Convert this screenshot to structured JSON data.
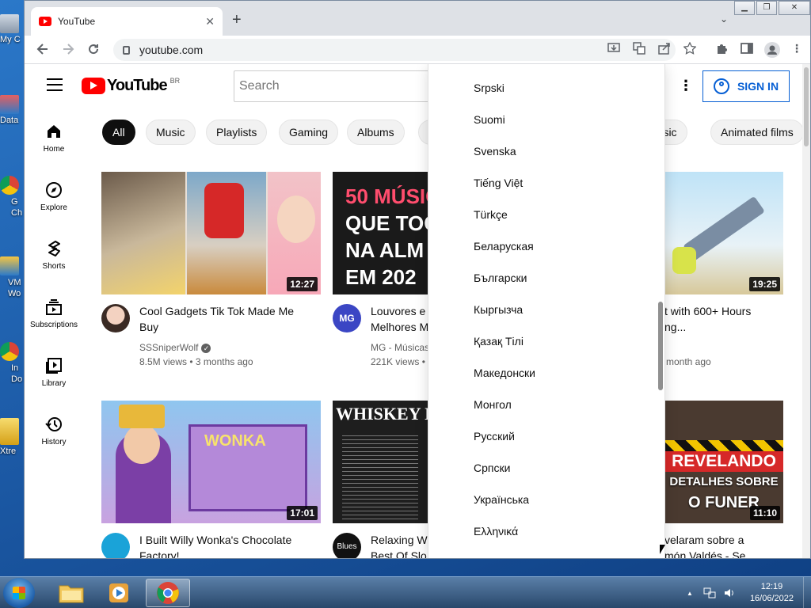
{
  "desktop": {
    "icons": [
      {
        "label": "My C"
      },
      {
        "label": "Data"
      },
      {
        "label": "G Ch"
      },
      {
        "label": "VM Wo"
      },
      {
        "label": "In Do"
      },
      {
        "label": "Xtre"
      }
    ]
  },
  "browser": {
    "tab_title": "YouTube",
    "tab_close": "✕",
    "new_tab": "+",
    "tab_search": "⌄",
    "url": "youtube.com",
    "win_minimize": "▁",
    "win_maximize": "❐",
    "win_close": "✕"
  },
  "youtube": {
    "logo_text": "YouTube",
    "country_code": "BR",
    "search_placeholder": "Search",
    "sign_in": "SIGN IN",
    "nav": [
      {
        "label": "Home"
      },
      {
        "label": "Explore"
      },
      {
        "label": "Shorts"
      },
      {
        "label": "Subscriptions"
      },
      {
        "label": "Library"
      },
      {
        "label": "History"
      }
    ],
    "chips": [
      "All",
      "Music",
      "Playlists",
      "Gaming",
      "Albums",
      "music",
      "Animated films"
    ],
    "videos": [
      {
        "title_l1": "Cool Gadgets Tik Tok Made Me",
        "title_l2": "Buy",
        "channel": "SSSniperWolf",
        "meta": "8.5M views • 3 months ago",
        "duration": "12:27"
      },
      {
        "title_l1": "Louvores e",
        "title_l2": "Melhores M",
        "channel": "MG - Músicas",
        "meta": "221K views •",
        "duration": "",
        "thumb_l1": "50 MÚSIC",
        "thumb_l2": "QUE TOCA",
        "thumb_l3": "NA ALM",
        "thumb_l4": "EM 202"
      },
      {
        "title_l1": "t with 600+ Hours",
        "title_l2": "ng...",
        "channel": "",
        "meta": "month ago",
        "duration": "19:25"
      },
      {
        "title_l1": "I Built Willy Wonka's Chocolate",
        "title_l2": "Factory!",
        "channel": "",
        "meta": "",
        "duration": "17:01",
        "thumb_text": "WONKA"
      },
      {
        "title_l1": "Relaxing Wh",
        "title_l2": "Best Of Slo",
        "channel": "",
        "meta": "",
        "duration": "",
        "thumb_text": "WHISKEY BLU"
      },
      {
        "title_l1": "velaram sobre a",
        "title_l2": "món Valdés - Se",
        "channel": "",
        "meta": "",
        "duration": "11:10",
        "thumb_l1": "REVELANDO",
        "thumb_l2": "DETALHES SOBRE",
        "thumb_l3": "O FUNER"
      }
    ],
    "languages": [
      "Srpski",
      "Suomi",
      "Svenska",
      "Tiếng Việt",
      "Türkçe",
      "Беларуская",
      "Български",
      "Кыргызча",
      "Қазақ Тілі",
      "Македонски",
      "Монгол",
      "Русский",
      "Српски",
      "Українська",
      "Ελληνικά"
    ]
  },
  "taskbar": {
    "time": "12:19",
    "date": "16/06/2022",
    "tray_arrow": "▲"
  }
}
